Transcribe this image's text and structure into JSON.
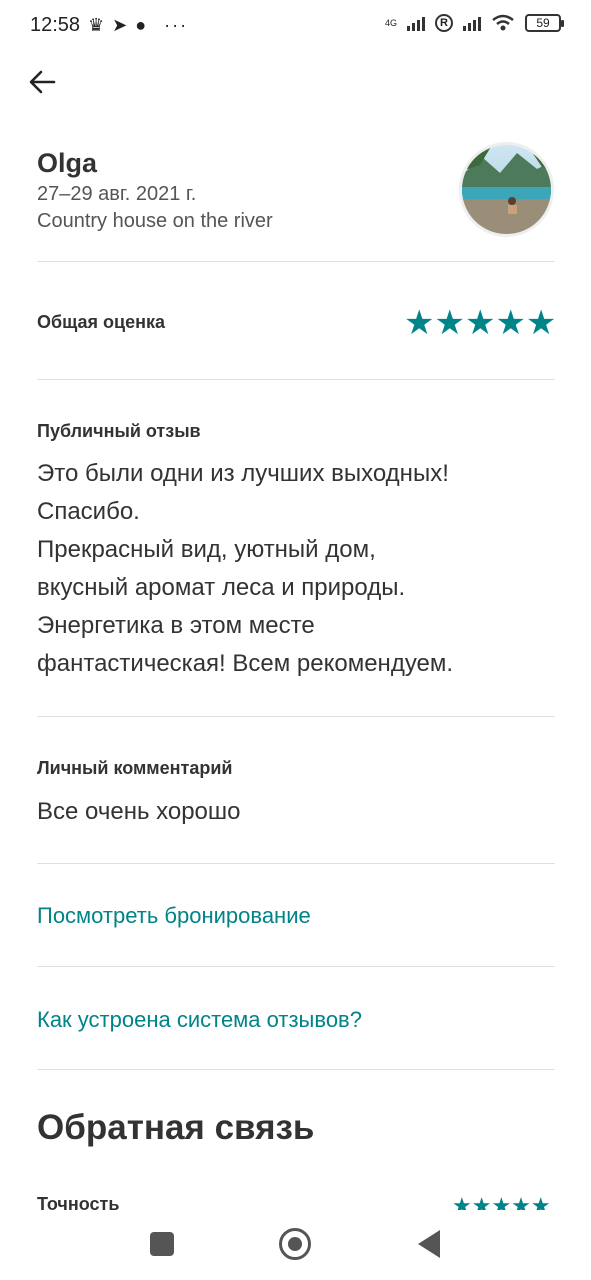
{
  "status_bar": {
    "time": "12:58",
    "battery": "59",
    "network": "4G",
    "icons": [
      "crown-icon",
      "telegram-icon",
      "fox-icon",
      "more-icon",
      "signal-icon",
      "r-icon",
      "signal-icon",
      "wifi-icon",
      "battery-icon"
    ]
  },
  "header": {
    "back_icon": "arrow-left-icon",
    "name": "Olga",
    "dates": "27–29 авг. 2021 г.",
    "listing": "Country house on the river"
  },
  "overall": {
    "label": "Общая оценка",
    "rating": 5,
    "stars": "★★★★★"
  },
  "public_review": {
    "label": "Публичный отзыв",
    "lines": [
      "Это были одни из лучших выходных!",
      "Спасибо.",
      "Прекрасный вид, уютный дом,",
      "вкусный аромат леса и природы.",
      "Энергетика в этом месте",
      "фантастическая! Всем рекомендуем."
    ]
  },
  "private_comment": {
    "label": "Личный комментарий",
    "text": "Все очень хорошо"
  },
  "links": {
    "view_booking": "Посмотреть бронирование",
    "how_reviews_work": "Как устроена система отзывов?"
  },
  "feedback": {
    "title": "Обратная связь",
    "first_row_label": "Точность",
    "first_row_stars": "★★★★★"
  },
  "colors": {
    "accent": "#008489",
    "text": "#333333"
  }
}
